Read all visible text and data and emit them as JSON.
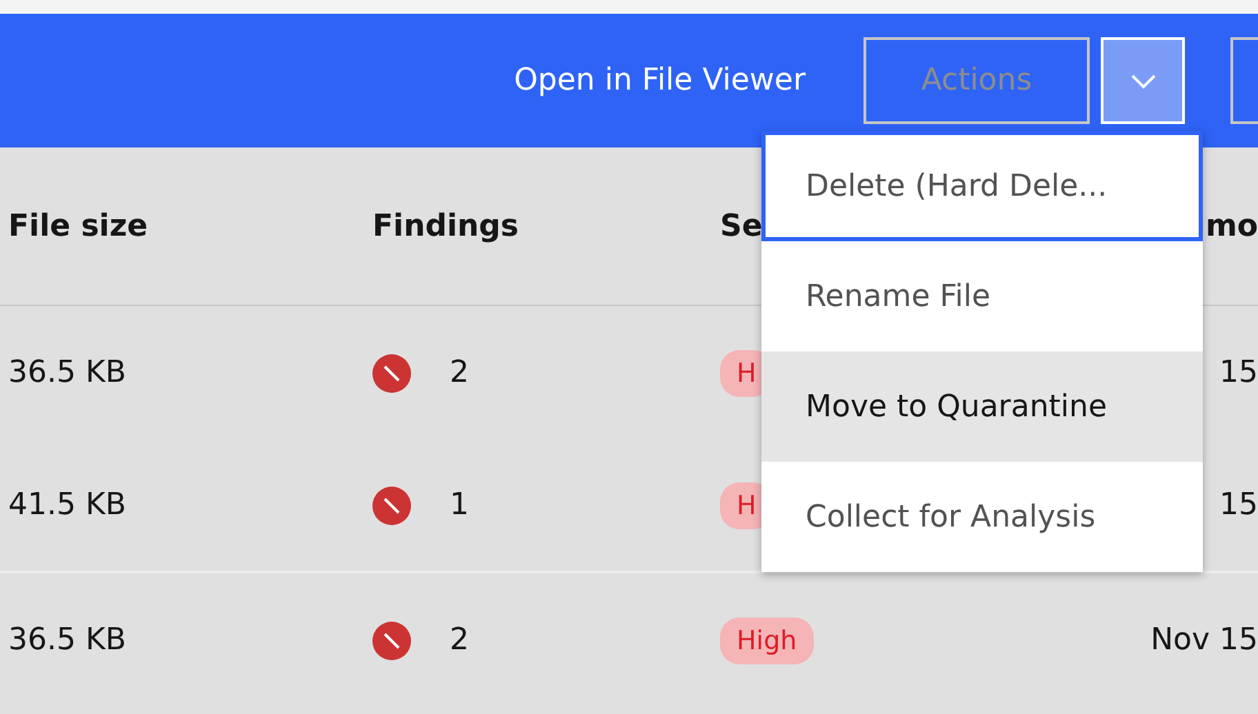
{
  "toolbar": {
    "link": "Open in File Viewer",
    "actions_button": {
      "label": "Actions",
      "disabled": true
    },
    "menu_button": {
      "expanded": true
    }
  },
  "table": {
    "columns": [
      {
        "label": "File size"
      },
      {
        "label": "Findings"
      },
      {
        "label": "Se"
      },
      {
        "label": "mo"
      }
    ],
    "rows": [
      {
        "file_size": "36.5 KB",
        "findings": "2",
        "severity": "H",
        "last_modified": "15"
      },
      {
        "file_size": "41.5 KB",
        "findings": "1",
        "severity": "H",
        "last_modified": "15"
      },
      {
        "file_size": "36.5 KB",
        "findings": "2",
        "severity": "High",
        "last_modified": "Nov 15"
      }
    ]
  },
  "menu": {
    "items": [
      {
        "label": "Delete (Hard Dele...",
        "focused": true,
        "highlighted": false
      },
      {
        "label": "Rename File",
        "focused": false,
        "highlighted": false
      },
      {
        "label": "Move to Quarantine",
        "focused": false,
        "highlighted": true
      },
      {
        "label": "Collect for Analysis",
        "focused": false,
        "highlighted": false
      }
    ]
  }
}
